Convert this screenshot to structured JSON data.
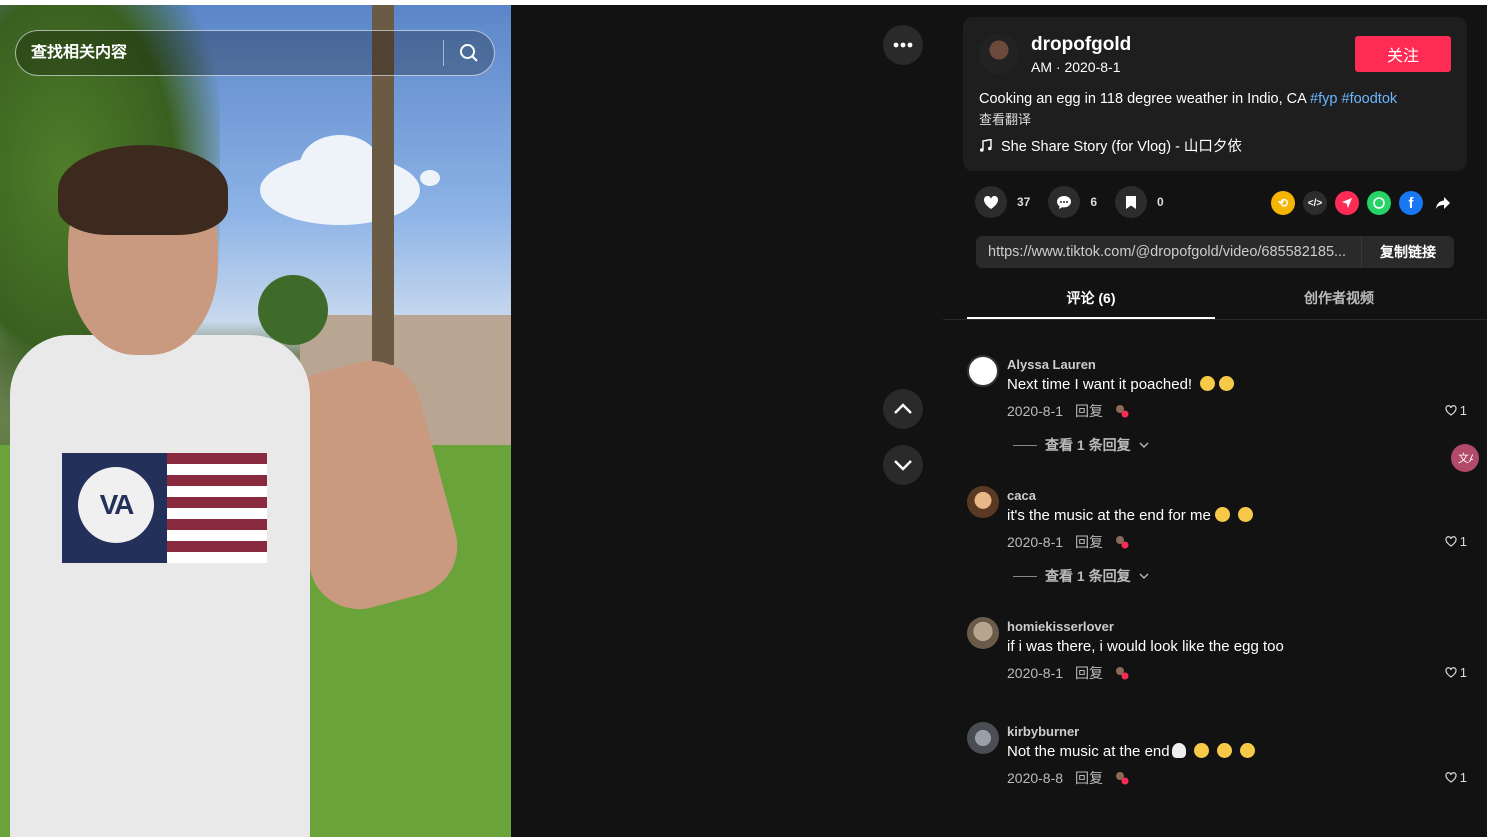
{
  "search": {
    "placeholder": "查找相关内容"
  },
  "video": {
    "logo_text": "VA"
  },
  "author": {
    "name": "dropofgold",
    "meta": "AM · 2020-8-1",
    "follow_label": "关注"
  },
  "post": {
    "caption": "Cooking an egg in 118 degree weather in Indio, CA",
    "tags": [
      "#fyp",
      "#foodtok"
    ],
    "translate_label": "查看翻译",
    "music": "She Share Story (for Vlog) - 山口夕依"
  },
  "actions": {
    "likes": "37",
    "comments": "6",
    "saves": "0"
  },
  "share": {
    "icons": [
      "repost-icon",
      "embed-icon",
      "send-icon",
      "whatsapp-icon",
      "facebook-icon",
      "share-arrow-icon"
    ],
    "colors": {
      "repost": "#f7b500",
      "embed": "#2c2c2c",
      "send": "#fe2c55",
      "whatsapp": "#25d366",
      "facebook": "#1877f2"
    }
  },
  "link": {
    "url": "https://www.tiktok.com/@dropofgold/video/685582185...",
    "copy_label": "复制链接"
  },
  "tabs": [
    {
      "label": "评论 (6)"
    },
    {
      "label": "创作者视频"
    }
  ],
  "comments": [
    {
      "user": "Alyssa Lauren",
      "text": "Next time I want it poached!",
      "emoji_count": 2,
      "date": "2020-8-1",
      "reply_label": "回复",
      "likes": "1",
      "replies": "查看 1 条回复",
      "avatar_color": "#ffffff"
    },
    {
      "user": "caca",
      "text": "it's the music at the end for me",
      "emoji_count": 2,
      "date": "2020-8-1",
      "reply_label": "回复",
      "likes": "1",
      "replies": "查看 1 条回复",
      "avatar_color": "#9b6a3c"
    },
    {
      "user": "homiekisserlover",
      "text": "if i was there, i would look like the egg too",
      "emoji_count": 0,
      "date": "2020-8-1",
      "reply_label": "回复",
      "likes": "1",
      "avatar_color": "#8a7a6a"
    },
    {
      "user": "kirbyburner",
      "text": "Not the music at the end",
      "emoji_count": 3,
      "date": "2020-8-8",
      "reply_label": "回复",
      "likes": "1",
      "avatar_color": "#6a6e74"
    }
  ],
  "colors": {
    "accent": "#fe2c55",
    "tag": "#6ab6ff",
    "background": "#121212"
  }
}
